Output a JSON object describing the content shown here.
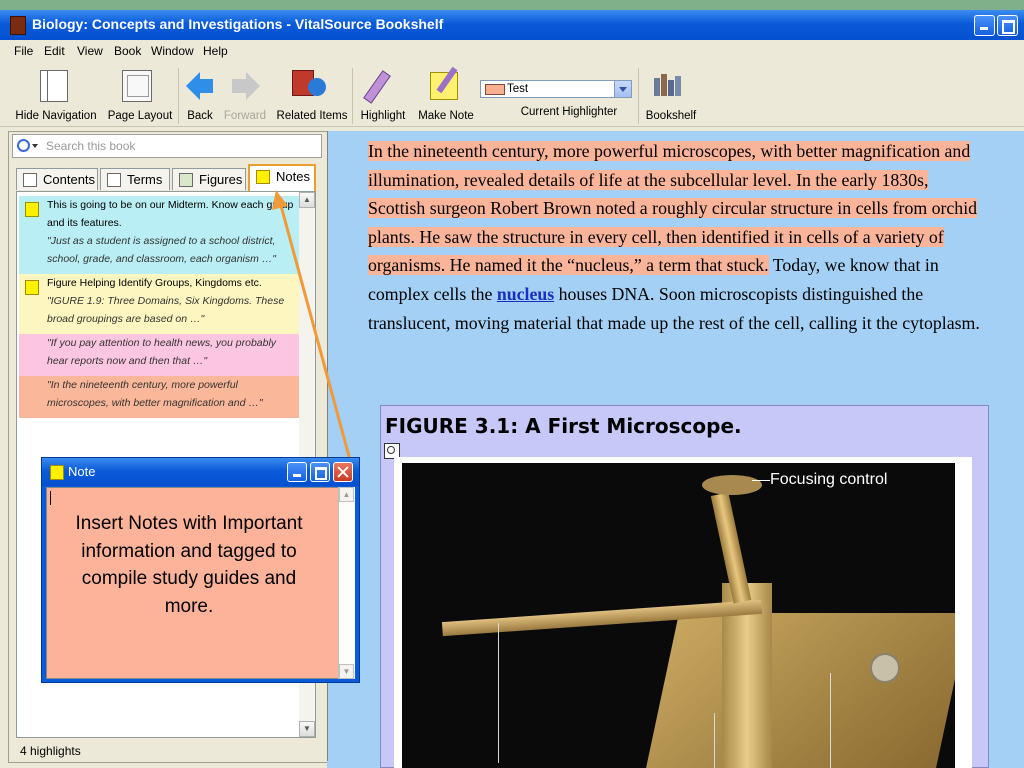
{
  "window": {
    "title": "Biology: Concepts and Investigations - VitalSource Bookshelf"
  },
  "menu": [
    "File",
    "Edit",
    "View",
    "Book",
    "Window",
    "Help"
  ],
  "toolbar": {
    "hide_navigation": "Hide Navigation",
    "page_layout": "Page Layout",
    "back": "Back",
    "forward": "Forward",
    "related_items": "Related Items",
    "highlight": "Highlight",
    "make_note": "Make Note",
    "current_highlighter_label": "Current Highlighter",
    "current_highlighter_value": "Test",
    "bookshelf": "Bookshelf"
  },
  "sidebar": {
    "search_placeholder": "Search this book",
    "tabs": [
      "Contents",
      "Terms",
      "Figures",
      "Notes"
    ],
    "active_tab": "Notes",
    "notes": [
      {
        "title": "This is going to be on our Midterm. Know each group and its features.",
        "quote": "\"Just as a student is assigned to a school district, school, grade, and classroom, each organism …\"",
        "color": "#b9eef4"
      },
      {
        "title": "Figure Helping Identify Groups, Kingdoms etc.",
        "quote": "\"IGURE 1.9:  Three Domains, Six Kingdoms. These broad groupings are based on …\"",
        "color": "#fdf6c0"
      },
      {
        "title": "",
        "quote": "\"If you pay attention to health news, you probably hear reports now and then that …\"",
        "color": "#fcc6e0"
      },
      {
        "title": "",
        "quote": "\"In the nineteenth century, more powerful microscopes, with better magnification and …\"",
        "color": "#fbb79a"
      }
    ],
    "status": "4 highlights"
  },
  "content": {
    "highlighted_text": "In the nineteenth century, more powerful microscopes, with better magnification and illumination, revealed details of life at the subcellular level. In the early 1830s, Scottish surgeon Robert Brown noted a roughly circular structure in cells from orchid plants. He saw the structure in every cell, then identified it in cells of a variety of organisms. He named it the “nucleus,” a term that stuck.",
    "text_before_link": " Today, we know that in complex cells the ",
    "link": "nucleus",
    "text_after_link": " houses DNA. Soon microscopists distinguished the translucent, moving material that made up the rest of the cell, calling it the cytoplasm.",
    "figure_title": "FIGURE 3.1:  A First Microscope.",
    "figure_label": "Focusing control"
  },
  "note_popup": {
    "title": "Note",
    "body": "Insert Notes with Important information and tagged to compile study guides and more."
  }
}
